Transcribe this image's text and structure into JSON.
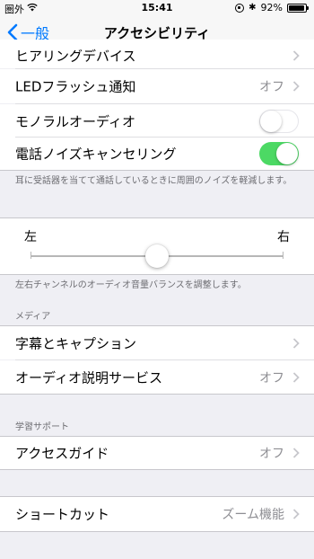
{
  "status_bar": {
    "carrier": "圏外",
    "time": "15:41",
    "battery": "92%",
    "battery_level": 0.92
  },
  "nav": {
    "back_label": "一般",
    "title": "アクセシビリティ"
  },
  "rows": {
    "hearing_devices": "ヒアリングデバイス",
    "led_flash": {
      "label": "LEDフラッシュ通知",
      "value": "オフ"
    },
    "mono_audio": {
      "label": "モノラルオーディオ",
      "on": false
    },
    "noise_cancel": {
      "label": "電話ノイズキャンセリング",
      "on": true
    }
  },
  "noise_footnote": "耳に受話器を当てて通話しているときに周囲のノイズを軽減します。",
  "balance": {
    "left_label": "左",
    "right_label": "右",
    "value": 0.5,
    "footnote": "左右チャンネルのオーディオ音量バランスを調整します。"
  },
  "media": {
    "header": "メディア",
    "subtitles": "字幕とキャプション",
    "audio_desc": {
      "label": "オーディオ説明サービス",
      "value": "オフ"
    }
  },
  "learning": {
    "header": "学習サポート",
    "guided_access": {
      "label": "アクセスガイド",
      "value": "オフ"
    }
  },
  "shortcut": {
    "label": "ショートカット",
    "value": "ズーム機能"
  },
  "colors": {
    "accent": "#007aff",
    "switch_on": "#4cd964",
    "background": "#efeff4"
  }
}
